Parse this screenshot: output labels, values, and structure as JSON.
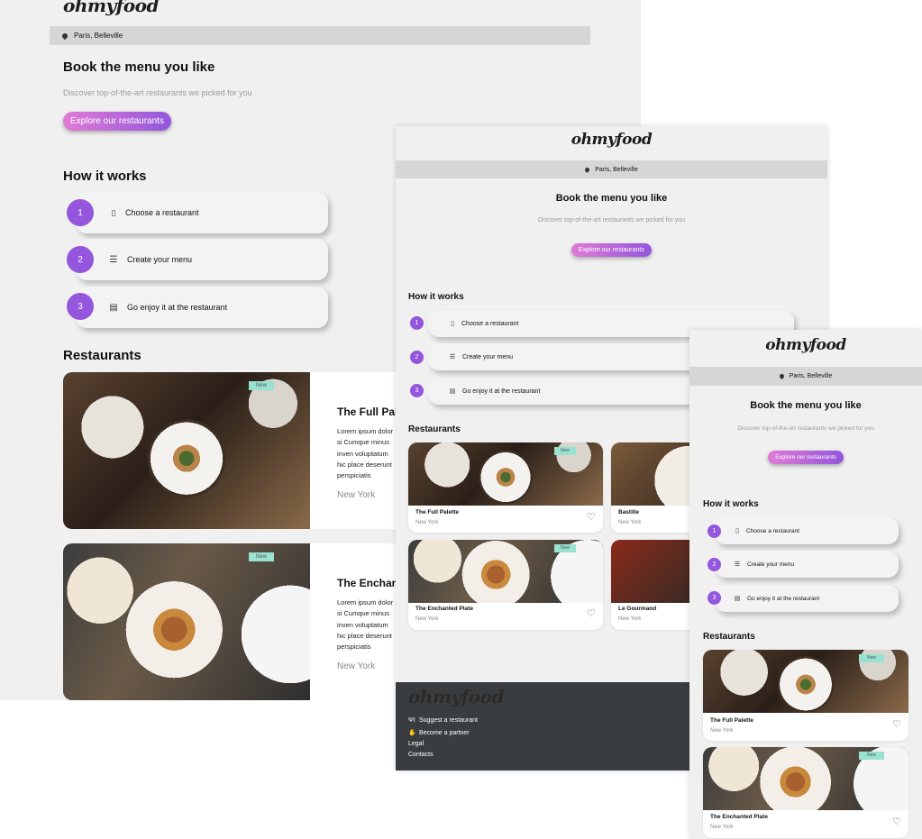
{
  "brand": "ohmyfood",
  "location": "Paris, Belleville",
  "hero": {
    "title": "Book the menu you like",
    "subtitle": "Discover top-of-the-art restaurants we picked for you",
    "cta": "Explore our restaurants"
  },
  "how": {
    "title": "How it works",
    "steps": [
      {
        "num": "1",
        "icon": "phone-icon",
        "label": "Choose a restaurant"
      },
      {
        "num": "2",
        "icon": "list-icon",
        "label": "Create your menu"
      },
      {
        "num": "3",
        "icon": "store-icon",
        "label": "Go enjoy it at the restaurant"
      }
    ]
  },
  "restaurants": {
    "title": "Restaurants",
    "badge": "New",
    "items": [
      {
        "name": "The Full Palette",
        "city": "New York",
        "name_cropped": "The Full Pale"
      },
      {
        "name": "The Enchanted Plate",
        "city": "New York",
        "name_cropped": "The Enchant"
      },
      {
        "name": "Bastille",
        "city": "New York"
      },
      {
        "name": "Le Gourmand",
        "city": "New York"
      }
    ],
    "lorem": "Lorem ipsum dolor si Cumque minus inven voluptatum hic place deserunt perspiciatis voluptate minus?"
  },
  "footer": {
    "links": [
      {
        "icon": "utensils-icon",
        "label": "Suggest a restaurant"
      },
      {
        "icon": "handshake-icon",
        "label": "Become a partner"
      },
      {
        "icon": "",
        "label": "Legal"
      },
      {
        "icon": "",
        "label": "Contacts"
      }
    ]
  },
  "colors": {
    "accent": "#9356dc",
    "gradient_start": "#e07bd6",
    "badge": "#99e2d0",
    "footer": "#3a3d3f",
    "background": "#f0f0f0",
    "location_bar": "#d6d6d6"
  }
}
